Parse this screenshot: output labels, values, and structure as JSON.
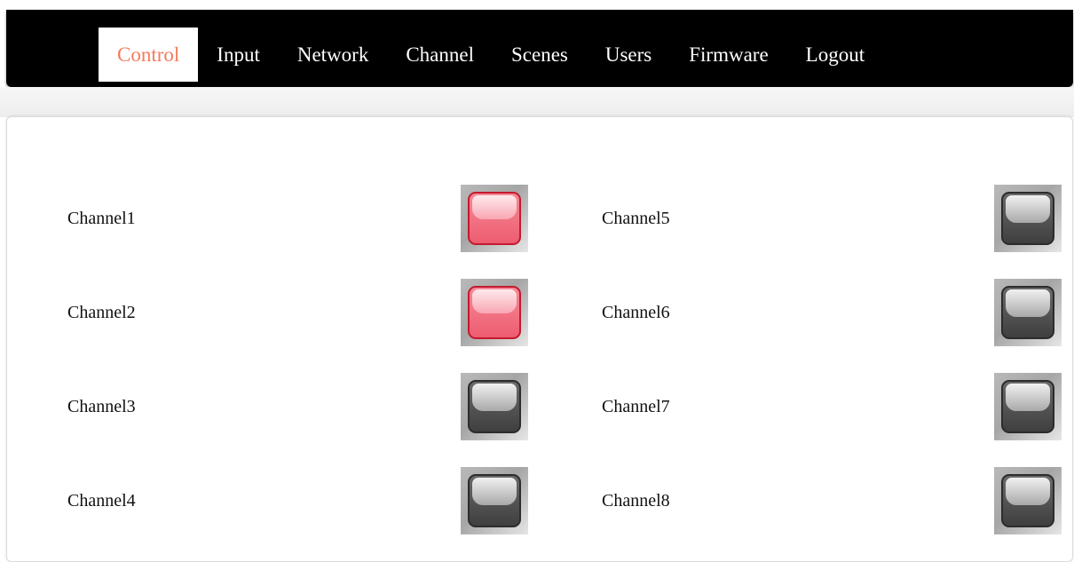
{
  "nav": {
    "items": [
      {
        "label": "Control",
        "active": true
      },
      {
        "label": "Input",
        "active": false
      },
      {
        "label": "Network",
        "active": false
      },
      {
        "label": "Channel",
        "active": false
      },
      {
        "label": "Scenes",
        "active": false
      },
      {
        "label": "Users",
        "active": false
      },
      {
        "label": "Firmware",
        "active": false
      },
      {
        "label": "Logout",
        "active": false
      }
    ]
  },
  "channels": [
    {
      "label": "Channel1",
      "state": "on"
    },
    {
      "label": "Channel2",
      "state": "on"
    },
    {
      "label": "Channel3",
      "state": "off"
    },
    {
      "label": "Channel4",
      "state": "off"
    },
    {
      "label": "Channel5",
      "state": "off"
    },
    {
      "label": "Channel6",
      "state": "off"
    },
    {
      "label": "Channel7",
      "state": "off"
    },
    {
      "label": "Channel8",
      "state": "off"
    }
  ],
  "colors": {
    "active_nav_text": "#f47a5c",
    "on": "#ee5c70",
    "off": "#4a4a4a"
  }
}
